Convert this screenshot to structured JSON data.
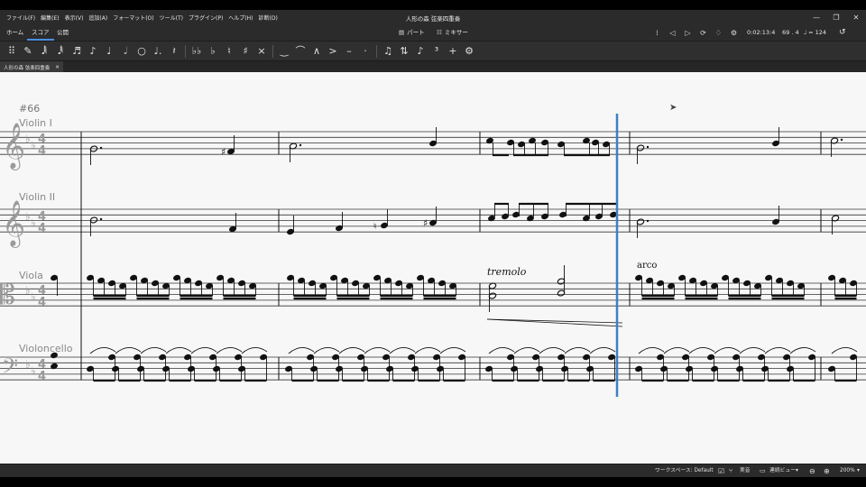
{
  "window": {
    "title": "人形の森 弦楽四重奏",
    "controls": [
      "—",
      "❐",
      "✕"
    ]
  },
  "menu": [
    "ファイル(F)",
    "編集(E)",
    "表示(V)",
    "追加(A)",
    "フォーマット(O)",
    "ツール(T)",
    "プラグイン(P)",
    "ヘルプ(H)",
    "診断(D)"
  ],
  "tabs": {
    "home": "ホーム",
    "score": "スコア",
    "publish": "公開",
    "parts": "パート",
    "mixer": "ミキサー"
  },
  "playback": {
    "time": "0:02:13:4",
    "position": "69 . 4",
    "tempo": "♩ = 124"
  },
  "toolbar_icons": [
    "drag-handle",
    "pen",
    "64th",
    "32nd",
    "16th",
    "8th",
    "quarter",
    "half",
    "whole",
    "dot",
    "rest",
    "double-flat",
    "flat",
    "natural",
    "sharp",
    "double-sharp",
    "tie",
    "slur",
    "marcato",
    "accent",
    "tenuto",
    "staccato",
    "beam",
    "flip",
    "grace",
    "tuplet",
    "add",
    "settings"
  ],
  "document_tab": {
    "label": "人形の森 弦楽四重奏"
  },
  "score": {
    "rehearsal_mark": "#66",
    "instruments": [
      "Violin I",
      "Violin II",
      "Viola",
      "Violoncello"
    ],
    "expressions": {
      "tremolo": "tremolo",
      "arco": "arco"
    }
  },
  "status": {
    "workspace": "ワークスペース: Default",
    "concert_pitch": "実音",
    "view_mode": "連続ビュー",
    "zoom": "200%"
  }
}
